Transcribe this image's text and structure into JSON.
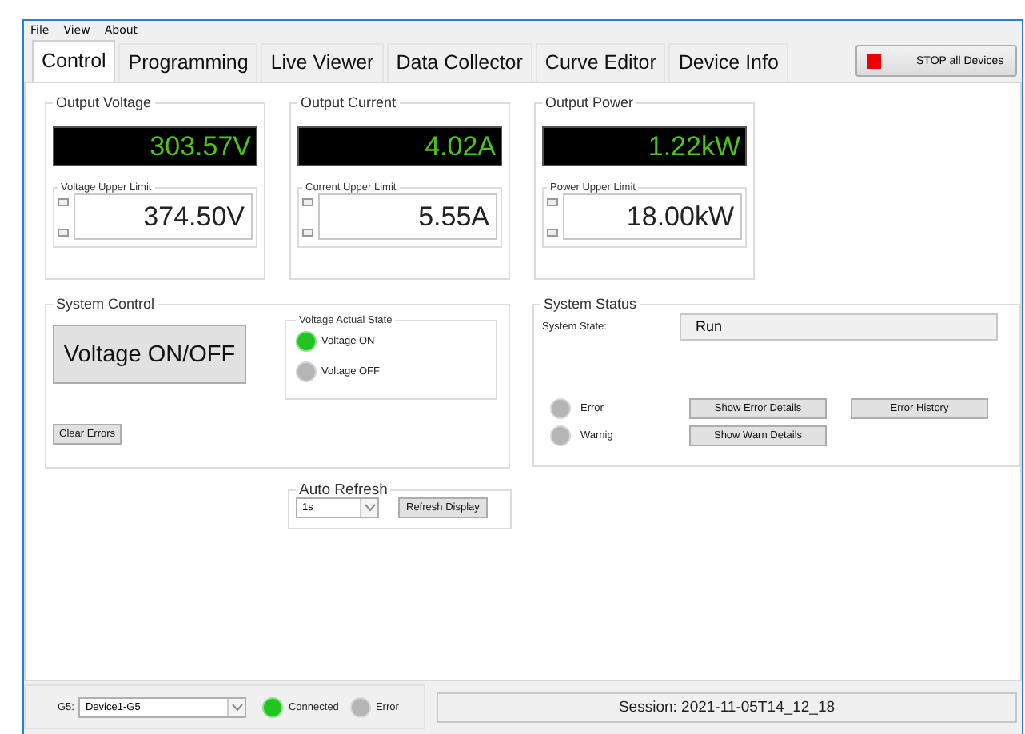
{
  "menu": [
    "File",
    "View",
    "About"
  ],
  "tabs": [
    {
      "label": "Control",
      "selected": true
    },
    {
      "label": "Programming",
      "selected": false
    },
    {
      "label": "Live Viewer",
      "selected": false
    },
    {
      "label": "Data Collector",
      "selected": false
    },
    {
      "label": "Curve Editor",
      "selected": false
    },
    {
      "label": "Device Info",
      "selected": false
    }
  ],
  "stop_button": {
    "label": "STOP all Devices"
  },
  "outputs": [
    {
      "title": "Output Voltage",
      "reading": "303.57V",
      "limit_label": "Voltage Upper Limit",
      "limit_value": "374.50V"
    },
    {
      "title": "Output Current",
      "reading": "4.02A",
      "limit_label": "Current Upper Limit",
      "limit_value": "5.55A"
    },
    {
      "title": "Output Power",
      "reading": "1.22kW",
      "limit_label": "Power Upper Limit",
      "limit_value": "18.00kW"
    }
  ],
  "system_control": {
    "title": "System Control",
    "toggle_button": "Voltage ON/OFF",
    "actual_state": {
      "title": "Voltage Actual State",
      "items": [
        {
          "label": "Voltage ON",
          "lit": true
        },
        {
          "label": "Voltage OFF",
          "lit": false
        }
      ]
    },
    "clear_button": "Clear Errors"
  },
  "system_status": {
    "title": "System Status",
    "state_label": "System State:",
    "state_value": "Run",
    "rows": [
      {
        "label": "Error",
        "lit": false,
        "buttons": [
          "Show Error Details",
          "Error History"
        ]
      },
      {
        "label": "Warnig",
        "lit": false,
        "buttons": [
          "Show Warn Details"
        ]
      }
    ]
  },
  "auto_refresh": {
    "title": "Auto Refresh",
    "interval": "1s",
    "button": "Refresh Display"
  },
  "status_bar": {
    "device_label": "G5:",
    "device": "Device1-G5",
    "indicators": [
      {
        "label": "Connected",
        "lit": true
      },
      {
        "label": "Error",
        "lit": false
      }
    ],
    "session": "Session: 2021-11-05T14_12_18"
  }
}
